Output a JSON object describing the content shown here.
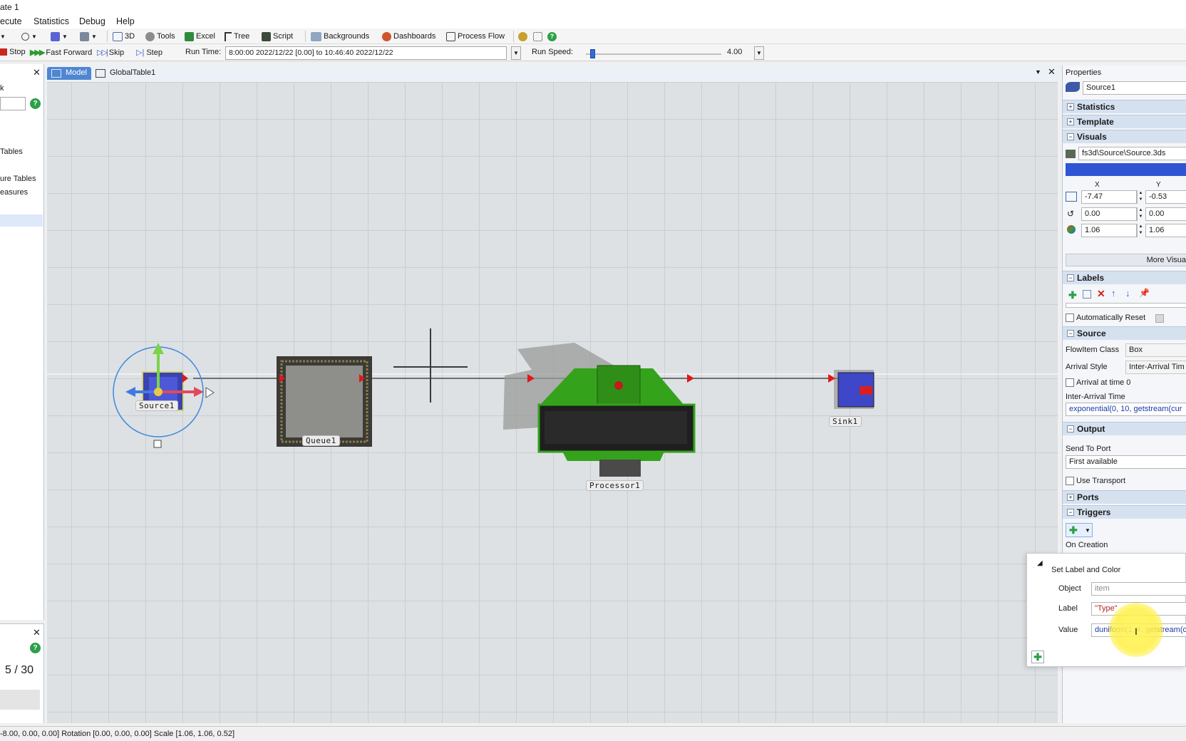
{
  "window": {
    "title": "ate 1"
  },
  "menu": [
    "ecute",
    "Statistics",
    "Debug",
    "Help"
  ],
  "toolbar": {
    "items": [
      "3D",
      "Tools",
      "Excel",
      "Tree",
      "Script",
      "Backgrounds",
      "Dashboards",
      "Process Flow"
    ]
  },
  "runbar": {
    "stop": "Stop",
    "fast_forward": "Fast Forward",
    "skip": "Skip",
    "step": "Step",
    "run_time_label": "Run Time:",
    "run_time_value": "8:00:00  2022/12/22  [0.00]    to    10:46:40  2022/12/22",
    "run_speed_label": "Run Speed:",
    "run_speed_value": "4.00",
    "run_speed_fraction": 0.05
  },
  "left_panel": {
    "tab_fragment": "k",
    "items": [
      "Tables",
      "ure Tables",
      "easures"
    ],
    "counter": "5 / 30"
  },
  "tabs": [
    {
      "label": "Model",
      "active": true
    },
    {
      "label": "GlobalTable1",
      "active": false
    }
  ],
  "model": {
    "objects": {
      "source": "Source1",
      "queue": "Queue1",
      "processor": "Processor1",
      "sink": "Sink1"
    }
  },
  "properties": {
    "title": "Properties",
    "object_name": "Source1",
    "sections": {
      "statistics": "Statistics",
      "template": "Template",
      "visuals": "Visuals",
      "labels": "Labels",
      "source": "Source",
      "output": "Output",
      "ports": "Ports",
      "triggers": "Triggers"
    },
    "visuals": {
      "shape_file": "fs3d\\Source\\Source.3ds",
      "color": "#2f55d4",
      "col_x": "X",
      "col_y": "Y",
      "position": [
        "-7.47",
        "-0.53"
      ],
      "rotation": [
        "0.00",
        "0.00"
      ],
      "size": [
        "1.06",
        "1.06"
      ],
      "more_visuals": "More Visua"
    },
    "labels_section": {
      "auto_reset": "Automatically Reset"
    },
    "source_section": {
      "flowitem_class_label": "FlowItem Class",
      "flowitem_class_value": "Box",
      "arrival_style_label": "Arrival Style",
      "arrival_style_value": "Inter-Arrival Tim",
      "arrival_at_time0": "Arrival at time 0",
      "inter_arrival_label": "Inter-Arrival Time",
      "inter_arrival_value": "exponential(0, 10, getstream(cur"
    },
    "output_section": {
      "send_to_port_label": "Send To Port",
      "send_to_port_value": "First available",
      "use_transport": "Use Transport"
    },
    "triggers_section": {
      "on_creation": "On Creation"
    }
  },
  "popup": {
    "title": "Set Label and Color",
    "object_label": "Object",
    "object_value": "item",
    "label_label": "Label",
    "label_value": "\"Type\"",
    "value_label": "Value",
    "value_value": "duniform(1, 4, getstream(cu"
  },
  "statusbar": {
    "text": "-8.00, 0.00, 0.00]  Rotation [0.00, 0.00, 0.00]  Scale [1.06, 1.06, 0.52]"
  }
}
